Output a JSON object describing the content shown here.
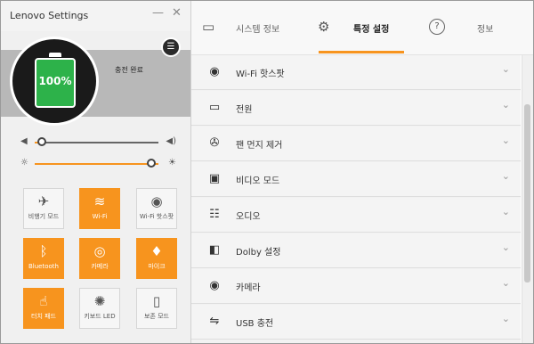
{
  "window": {
    "title": "Lenovo Settings",
    "minimize": "—",
    "close": "✕"
  },
  "battery": {
    "percent": "100%",
    "status": "충전 완료",
    "level": 1.0
  },
  "volume": {
    "level": 0.06
  },
  "brightness": {
    "level": 0.94
  },
  "quick_toggles": [
    {
      "label": "비행기 모드",
      "icon": "airplane-icon",
      "glyph": "✈",
      "on": false
    },
    {
      "label": "Wi-Fi",
      "icon": "wifi-icon",
      "glyph": "≋",
      "on": true
    },
    {
      "label": "Wi-Fi 핫스팟",
      "icon": "hotspot-icon",
      "glyph": "◉",
      "on": false
    },
    {
      "label": "Bluetooth",
      "icon": "bluetooth-icon",
      "glyph": "ᛒ",
      "on": true
    },
    {
      "label": "카메라",
      "icon": "camera-icon",
      "glyph": "◎",
      "on": true
    },
    {
      "label": "마이크",
      "icon": "microphone-icon",
      "glyph": "♦",
      "on": true
    },
    {
      "label": "터치 패드",
      "icon": "touchpad-icon",
      "glyph": "☝",
      "on": true
    },
    {
      "label": "키보드 LED",
      "icon": "keyboard-led-icon",
      "glyph": "✺",
      "on": false
    },
    {
      "label": "보존 모드",
      "icon": "conservation-mode-icon",
      "glyph": "▯",
      "on": false
    }
  ],
  "tabs": [
    {
      "label": "시스템 정보",
      "icon": "monitor-icon",
      "glyph": "▭",
      "active": false
    },
    {
      "label": "특정 설정",
      "icon": "gear-icon",
      "glyph": "⚙",
      "active": true
    },
    {
      "label": "정보",
      "icon": "help-icon",
      "glyph": "?",
      "active": false
    }
  ],
  "settings": [
    {
      "label": "Wi-Fi 핫스팟",
      "icon": "hotspot-icon",
      "glyph": "◉"
    },
    {
      "label": "전원",
      "icon": "power-plug-icon",
      "glyph": "▭"
    },
    {
      "label": "팬 먼지 제거",
      "icon": "fan-icon",
      "glyph": "✇"
    },
    {
      "label": "비디오 모드",
      "icon": "video-icon",
      "glyph": "▣"
    },
    {
      "label": "오디오",
      "icon": "audio-equalizer-icon",
      "glyph": "☷"
    },
    {
      "label": "Dolby 설정",
      "icon": "dolby-icon",
      "glyph": "◧"
    },
    {
      "label": "카메라",
      "icon": "webcam-icon",
      "glyph": "◉"
    },
    {
      "label": "USB 충전",
      "icon": "usb-icon",
      "glyph": "⇋"
    }
  ],
  "chevron": "⌄",
  "colors": {
    "accent": "#f7941e",
    "battery": "#2db24a"
  }
}
